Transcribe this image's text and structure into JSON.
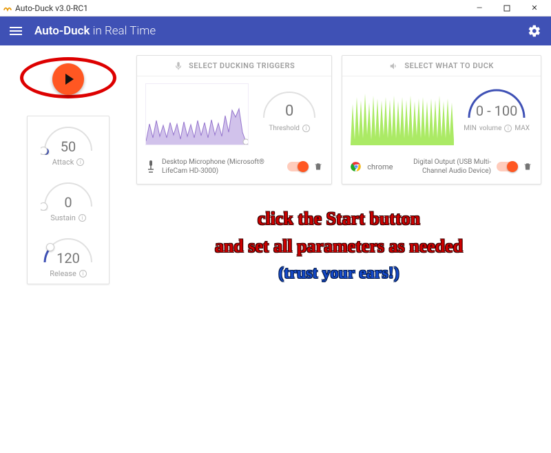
{
  "window": {
    "title": "Auto-Duck v3.0-RC1"
  },
  "appbar": {
    "name_bold": "Auto-Duck",
    "name_light": " in Real Time"
  },
  "params": {
    "attack": {
      "value": "50",
      "label": "Attack"
    },
    "sustain": {
      "value": "0",
      "label": "Sustain"
    },
    "release": {
      "value": "120",
      "label": "Release"
    }
  },
  "triggers": {
    "header": "SELECT DUCKING TRIGGERS",
    "threshold": {
      "value": "0",
      "label": "Threshold"
    },
    "device": "Desktop Microphone (Microsoft® LifeCam HD-3000)"
  },
  "ducked": {
    "header": "SELECT WHAT TO DUCK",
    "volume_range": "0 - 100",
    "min": "MIN",
    "max": "MAX",
    "volume_label": "volume",
    "app_name": "chrome",
    "output": "Digital Output (USB Multi-Channel Audio Device)"
  },
  "annot": {
    "line1": "click the Start button",
    "line2": "and set all parameters as needed",
    "line3": "(trust your ears!)"
  }
}
